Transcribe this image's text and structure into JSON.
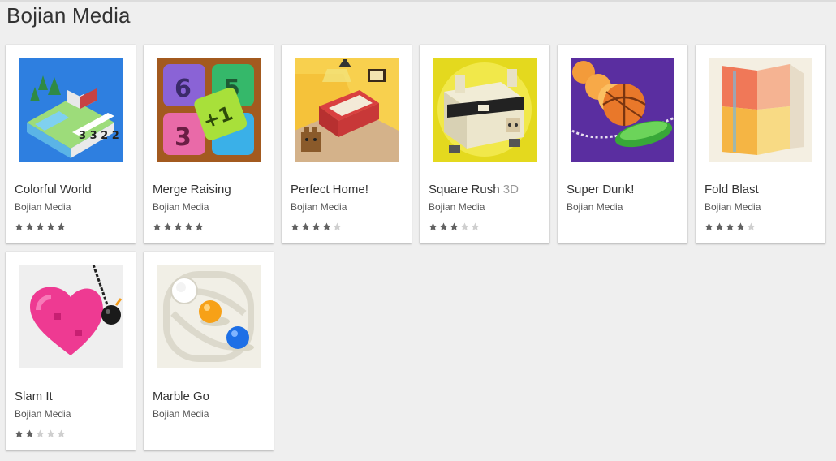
{
  "page": {
    "title": "Bojian Media"
  },
  "apps": [
    {
      "title": "Colorful World",
      "developer": "Bojian Media",
      "rating": 4.5,
      "icon": "colorful-world-icon"
    },
    {
      "title": "Merge Raising",
      "developer": "Bojian Media",
      "rating": 4.5,
      "icon": "merge-raising-icon"
    },
    {
      "title": "Perfect Home!",
      "developer": "Bojian Media",
      "rating": 4.0,
      "icon": "perfect-home-icon"
    },
    {
      "title": "Square Rush",
      "title_suffix": "3D",
      "developer": "Bojian Media",
      "rating": 3.0,
      "icon": "square-rush-icon"
    },
    {
      "title": "Super Dunk!",
      "developer": "Bojian Media",
      "rating": null,
      "icon": "super-dunk-icon"
    },
    {
      "title": "Fold Blast",
      "developer": "Bojian Media",
      "rating": 3.5,
      "icon": "fold-blast-icon"
    },
    {
      "title": "Slam It",
      "developer": "Bojian Media",
      "rating": 2.0,
      "icon": "slam-it-icon"
    },
    {
      "title": "Marble Go",
      "developer": "Bojian Media",
      "rating": null,
      "icon": "marble-go-icon"
    }
  ],
  "colors": {
    "star_filled": "#616161",
    "star_empty": "#cfcfcf",
    "background": "#efefef"
  }
}
